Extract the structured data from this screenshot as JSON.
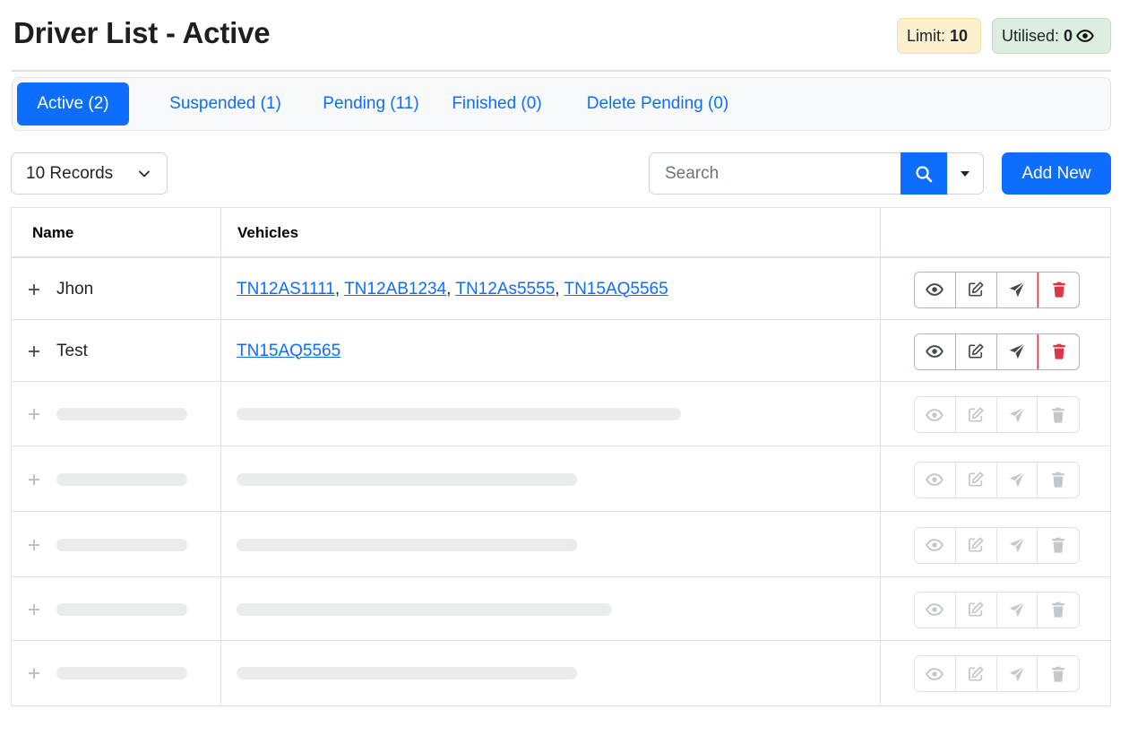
{
  "header": {
    "title": "Driver List - Active",
    "limit_label": "Limit:",
    "limit_value": "10",
    "utilised_label": "Utilised:",
    "utilised_value": "0"
  },
  "tabs": [
    {
      "label": "Active (2)",
      "active": true
    },
    {
      "label": "Suspended (1)",
      "active": false
    },
    {
      "label": "Pending (11)",
      "active": false
    },
    {
      "label": "Finished (0)",
      "active": false
    },
    {
      "label": "Delete Pending (0)",
      "active": false
    }
  ],
  "toolbar": {
    "records_select": "10 Records",
    "search_placeholder": "Search",
    "add_label": "Add New"
  },
  "table": {
    "columns": [
      "Name",
      "Vehicles",
      ""
    ],
    "rows": [
      {
        "name": "Jhon",
        "vehicles": [
          "TN12AS1111",
          "TN12AB1234",
          "TN12As5555",
          "TN15AQ5565"
        ]
      },
      {
        "name": "Test",
        "vehicles": [
          "TN15AQ5565"
        ]
      }
    ],
    "placeholder_rows": 5
  },
  "icons": {
    "view": "eye-icon",
    "edit": "edit-icon",
    "send": "send-icon",
    "delete": "trash-icon",
    "expand": "plus-icon",
    "search": "search-icon"
  },
  "colors": {
    "primary": "#0d6efd",
    "danger": "#dc3545",
    "limit_badge_bg": "#fdf0cf",
    "utilised_badge_bg": "#dbeee0"
  }
}
